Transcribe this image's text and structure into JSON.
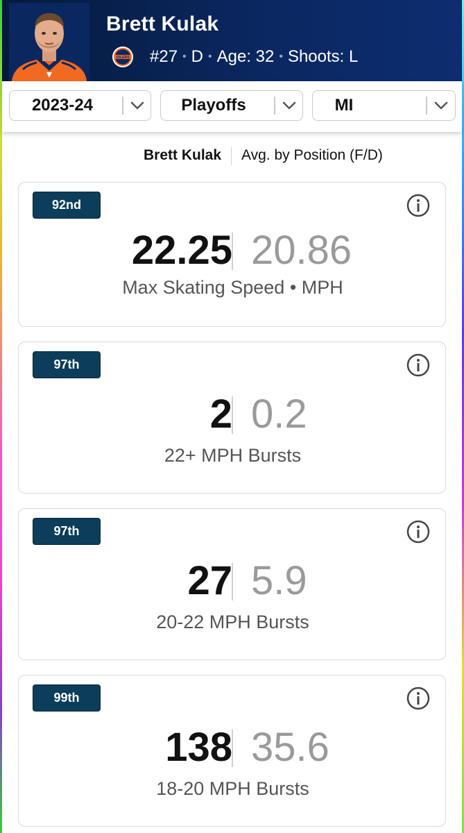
{
  "player": {
    "name": "Brett Kulak",
    "number": "#27",
    "position": "D",
    "age": "Age: 32",
    "shoots": "Shoots: L",
    "team_logo_text": "OILERS"
  },
  "filters": {
    "season": "2023-24",
    "game_type": "Playoffs",
    "units": "MI"
  },
  "legend": {
    "player_label": "Brett Kulak",
    "avg_label": "Avg. by Position (F/D)"
  },
  "cards": [
    {
      "percentile": "92nd",
      "player_value": "22.25",
      "avg_value": "20.86",
      "metric": "Max Skating Speed • MPH"
    },
    {
      "percentile": "97th",
      "player_value": "2",
      "avg_value": "0.2",
      "metric": "22+ MPH Bursts"
    },
    {
      "percentile": "97th",
      "player_value": "27",
      "avg_value": "5.9",
      "metric": "20-22 MPH Bursts"
    },
    {
      "percentile": "99th",
      "player_value": "138",
      "avg_value": "35.6",
      "metric": "18-20 MPH Bursts"
    }
  ],
  "colors": {
    "header_bg": "#0b2760",
    "badge_bg": "#0c3d5a",
    "avg_value": "#9a9a9c",
    "jersey_orange": "#f26a21"
  },
  "icons": {
    "info": "info-circle-icon",
    "dropdown": "chevron-down-icon",
    "team": "oilers-logo"
  }
}
